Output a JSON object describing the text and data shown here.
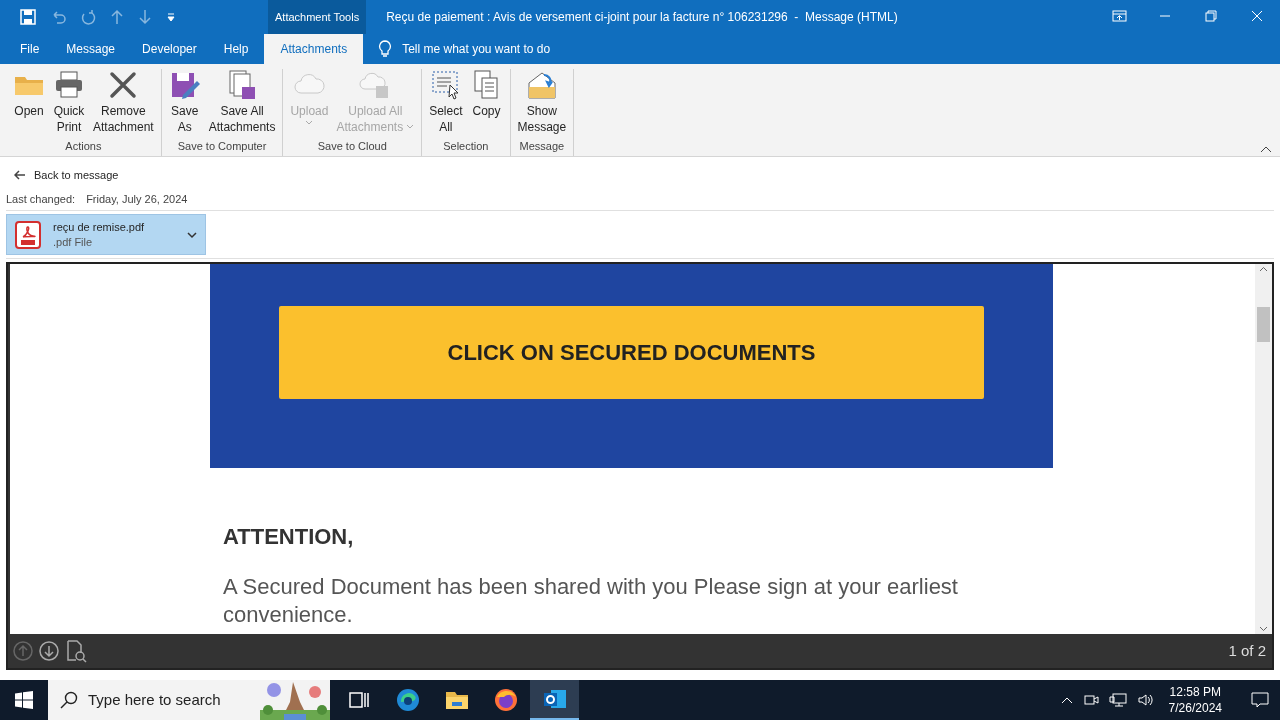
{
  "title_bar": {
    "context_tab": "Attachment Tools",
    "title": "Reçu de paiement : Avis de versement ci-joint pour la facture n° 106231296  -  Message (HTML)"
  },
  "tabs": [
    {
      "label": "File",
      "selected": false
    },
    {
      "label": "Message",
      "selected": false
    },
    {
      "label": "Developer",
      "selected": false
    },
    {
      "label": "Help",
      "selected": false
    },
    {
      "label": "Attachments",
      "selected": true
    }
  ],
  "tell_me": {
    "placeholder": "Tell me what you want to do"
  },
  "ribbon_groups": [
    {
      "label": "Actions",
      "buttons": [
        {
          "kind": "open",
          "label": [
            "Open"
          ],
          "disabled": false,
          "dropdown": false
        },
        {
          "kind": "print",
          "label": [
            "Quick",
            "Print"
          ],
          "disabled": false,
          "dropdown": false
        },
        {
          "kind": "remove",
          "label": [
            "Remove",
            "Attachment"
          ],
          "disabled": false,
          "dropdown": false
        }
      ]
    },
    {
      "label": "Save to Computer",
      "buttons": [
        {
          "kind": "save_as",
          "label": [
            "Save",
            "As"
          ],
          "disabled": false,
          "dropdown": false
        },
        {
          "kind": "save_all",
          "label": [
            "Save All",
            "Attachments"
          ],
          "disabled": false,
          "dropdown": false
        }
      ]
    },
    {
      "label": "Save to Cloud",
      "buttons": [
        {
          "kind": "upload",
          "label": [
            "Upload"
          ],
          "disabled": true,
          "dropdown": true
        },
        {
          "kind": "upload_all",
          "label": [
            "Upload All",
            "Attachments"
          ],
          "disabled": true,
          "dropdown": true
        }
      ]
    },
    {
      "label": "Selection",
      "buttons": [
        {
          "kind": "select_all",
          "label": [
            "Select",
            "All"
          ],
          "disabled": false,
          "dropdown": false
        },
        {
          "kind": "copy",
          "label": [
            "Copy"
          ],
          "disabled": false,
          "dropdown": false
        }
      ]
    },
    {
      "label": "Message",
      "buttons": [
        {
          "kind": "show_message",
          "label": [
            "Show",
            "Message"
          ],
          "disabled": false,
          "dropdown": false
        }
      ]
    }
  ],
  "back_link": "Back to message",
  "last_changed": {
    "label": "Last changed:",
    "value": "Friday, July 26, 2024"
  },
  "attachment": {
    "name": "reçu de remise.pdf",
    "type": ".pdf File",
    "selected": true
  },
  "preview": {
    "button": "CLICK ON SECURED DOCUMENTS",
    "heading": "ATTENTION,",
    "paragraph": "A Secured Document has been shared with you Please sign at your earliest convenience.",
    "page": "1 of 2"
  },
  "taskbar": {
    "search_placeholder": "Type here to search",
    "apps": [
      {
        "kind": "task_view",
        "selected": false
      },
      {
        "kind": "edge",
        "selected": false
      },
      {
        "kind": "explorer",
        "selected": false
      },
      {
        "kind": "firefox",
        "selected": false
      },
      {
        "kind": "outlook",
        "selected": true
      }
    ],
    "time": "12:58 PM",
    "date": "7/26/2024"
  }
}
